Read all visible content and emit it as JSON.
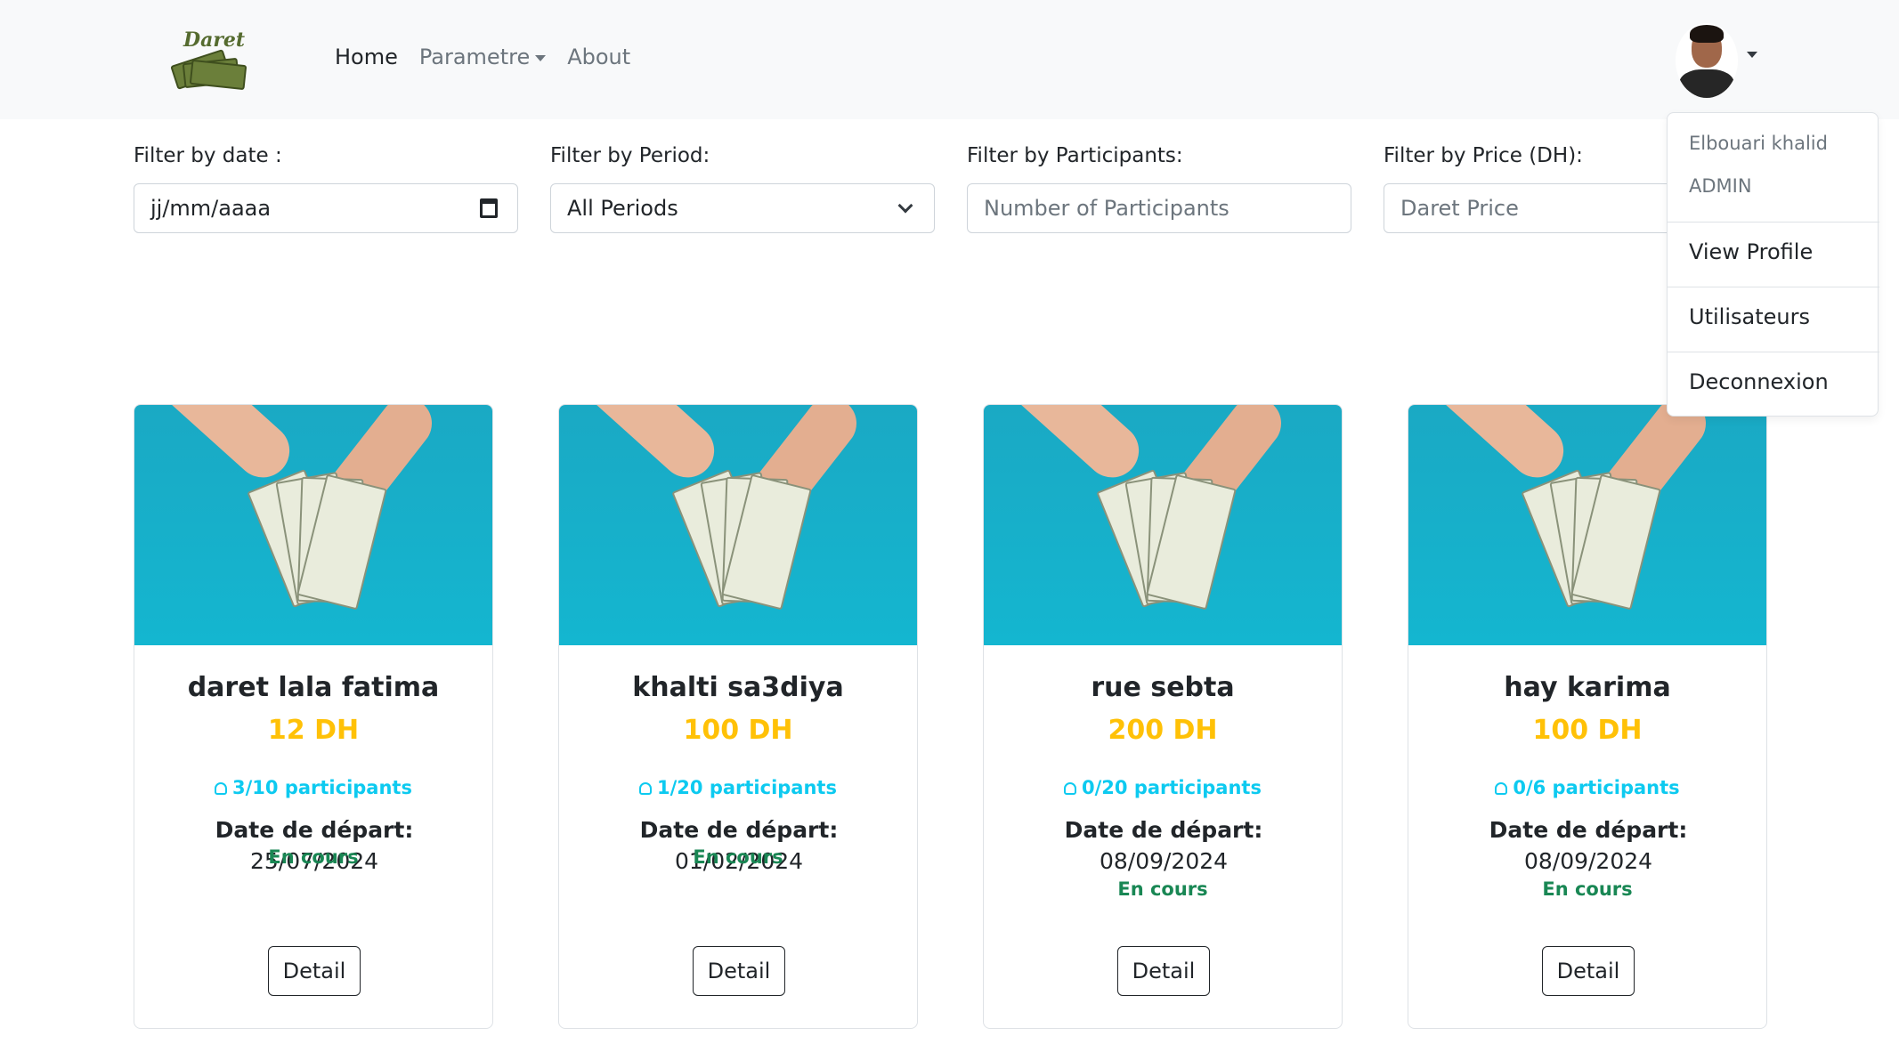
{
  "navbar": {
    "logo_text": "Daret",
    "links": [
      "Home",
      "Parametre",
      "About"
    ]
  },
  "filters": {
    "date": {
      "label": "Filter by date :",
      "value": "jj/mm/aaaa"
    },
    "period": {
      "label": "Filter by Period:",
      "value": "All Periods"
    },
    "participants": {
      "label": "Filter by Participants:",
      "placeholder": "Number of Participants"
    },
    "price": {
      "label": "Filter by Price (DH):",
      "placeholder": "Daret Price"
    }
  },
  "cards": [
    {
      "title": "daret lala fatima",
      "price": "12 DH",
      "participants": "3/10 participants",
      "date_label": "Date de départ:",
      "date": "25/07/2024",
      "status": "En cours",
      "button": "Detail"
    },
    {
      "title": "khalti sa3diya",
      "price": "100 DH",
      "participants": "1/20 participants",
      "date_label": "Date de départ:",
      "date": "01/02/2024",
      "status": "En cours",
      "button": "Detail"
    },
    {
      "title": "rue sebta",
      "price": "200 DH",
      "participants": "0/20 participants",
      "date_label": "Date de départ:",
      "date": "08/09/2024",
      "status": "En cours",
      "button": "Detail"
    },
    {
      "title": "hay karima",
      "price": "100 DH",
      "participants": "0/6 participants",
      "date_label": "Date de départ:",
      "date": "08/09/2024",
      "status": "En cours",
      "button": "Detail"
    }
  ],
  "user_menu": {
    "name": "Elbouari khalid",
    "role": "ADMIN",
    "items": [
      "View Profile",
      "Utilisateurs",
      "Deconnexion"
    ]
  },
  "colors": {
    "price": "#ffc107",
    "participants": "#0dcaf0",
    "status": "#198754",
    "navbar_bg": "#f8f9fa",
    "card_image_bg": "#14b6d0"
  }
}
